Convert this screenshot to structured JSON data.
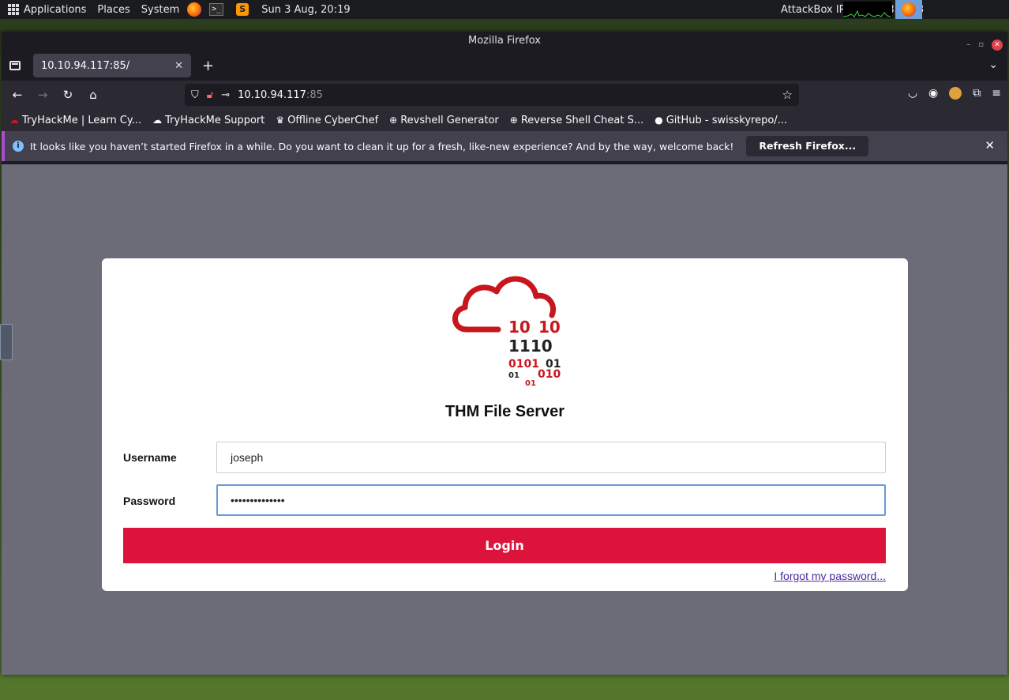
{
  "panel": {
    "menu": [
      "Applications",
      "Places",
      "System"
    ],
    "datetime": "Sun 3 Aug, 20:19",
    "attackbox_ip": "AttackBox IP:10.10.233.108"
  },
  "window": {
    "title": "Mozilla Firefox"
  },
  "tab": {
    "label": "10.10.94.117:85/"
  },
  "urlbar": {
    "host": "10.10.94.117",
    "port": ":85"
  },
  "bookmarks": [
    "TryHackMe | Learn Cy...",
    "TryHackMe Support",
    "Offline CyberChef",
    "Revshell Generator",
    "Reverse Shell Cheat S...",
    "GitHub - swisskyrepo/..."
  ],
  "notification": {
    "message": "It looks like you haven’t started Firefox in a while. Do you want to clean it up for a fresh, like-new experience? And by the way, welcome back!",
    "button": "Refresh Firefox..."
  },
  "login": {
    "logo_binary": [
      "10",
      "10",
      "1110",
      "0101",
      "01",
      "01",
      "010",
      "01"
    ],
    "title": "THM File Server",
    "username_label": "Username",
    "username_value": "joseph",
    "password_label": "Password",
    "password_value": "••••••••••••••",
    "button": "Login",
    "forgot": "I forgot my password..."
  },
  "colors": {
    "brand_red": "#dc143c",
    "logo_red": "#c8161d",
    "page_bg": "#6b6c77"
  }
}
